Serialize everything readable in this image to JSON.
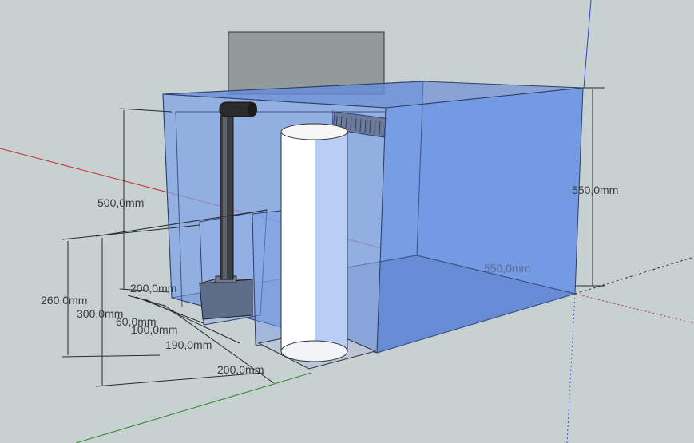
{
  "colors": {
    "background": "#c7d1d2",
    "glass_blue": "#6f98e6",
    "glass_blue_dark": "#5f86d3",
    "baffle_gray": "#7d8789",
    "pipe_dark": "#333333",
    "cylinder_white": "#ffffff",
    "axis_red": "#c8282d",
    "axis_green": "#2b8a2b",
    "axis_blue": "#2d3fd6",
    "dimension_line": "#2a2a2a"
  },
  "icons": [
    "pipe-elbow",
    "pump-block",
    "reactor-cylinder",
    "overflow-comb"
  ],
  "dimensions": {
    "height_550": "550,0mm",
    "depth_550": "550,0mm",
    "height_500": "500,0mm",
    "width_200_top": "200,0mm",
    "height_260": "260,0mm",
    "height_300": "300,0mm",
    "width_60": "60,0mm",
    "width_100": "100,0mm",
    "width_190": "190,0mm",
    "width_200_front": "200,0mm"
  }
}
